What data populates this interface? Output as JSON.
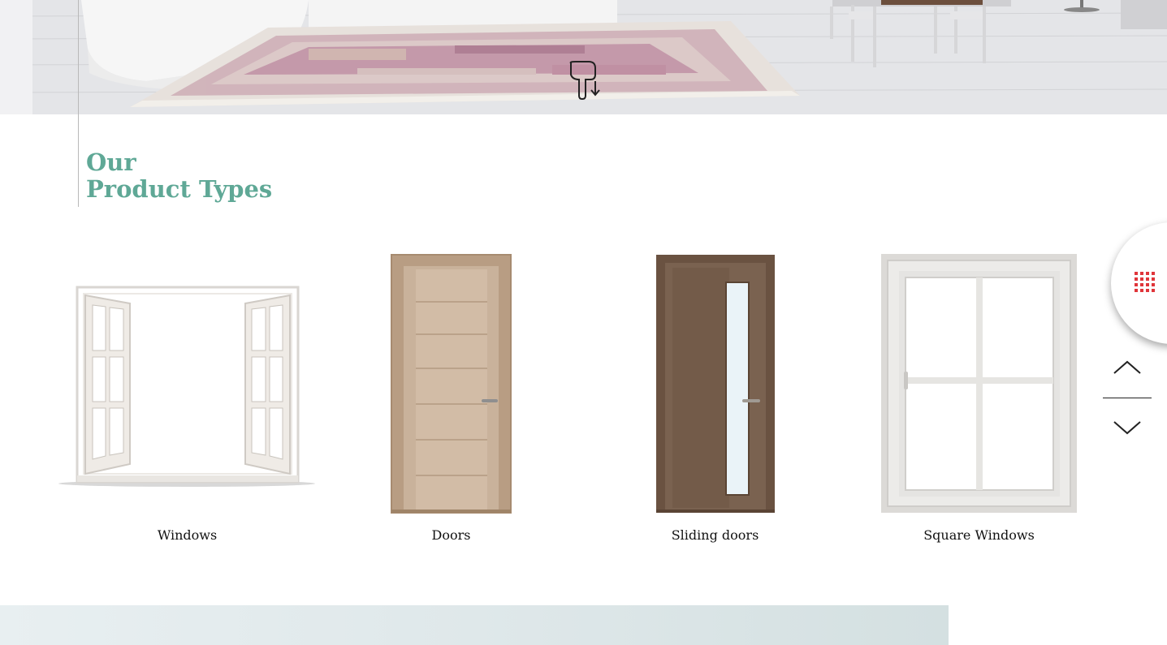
{
  "hero": {
    "icon": "scroll-down-hand-icon"
  },
  "section": {
    "title_line1": "Our",
    "title_line2": "Product Types",
    "accent_color": "#5fa896"
  },
  "products": [
    {
      "label": "Windows",
      "icon": "open-window-image"
    },
    {
      "label": "Doors",
      "icon": "wooden-door-image"
    },
    {
      "label": "Sliding doors",
      "icon": "glass-panel-door-image"
    },
    {
      "label": "Square Windows",
      "icon": "square-window-image"
    }
  ],
  "controls": {
    "menu_icon": "grid-menu-icon",
    "menu_color": "#e0353a",
    "up_icon": "chevron-up-icon",
    "down_icon": "chevron-down-icon"
  }
}
